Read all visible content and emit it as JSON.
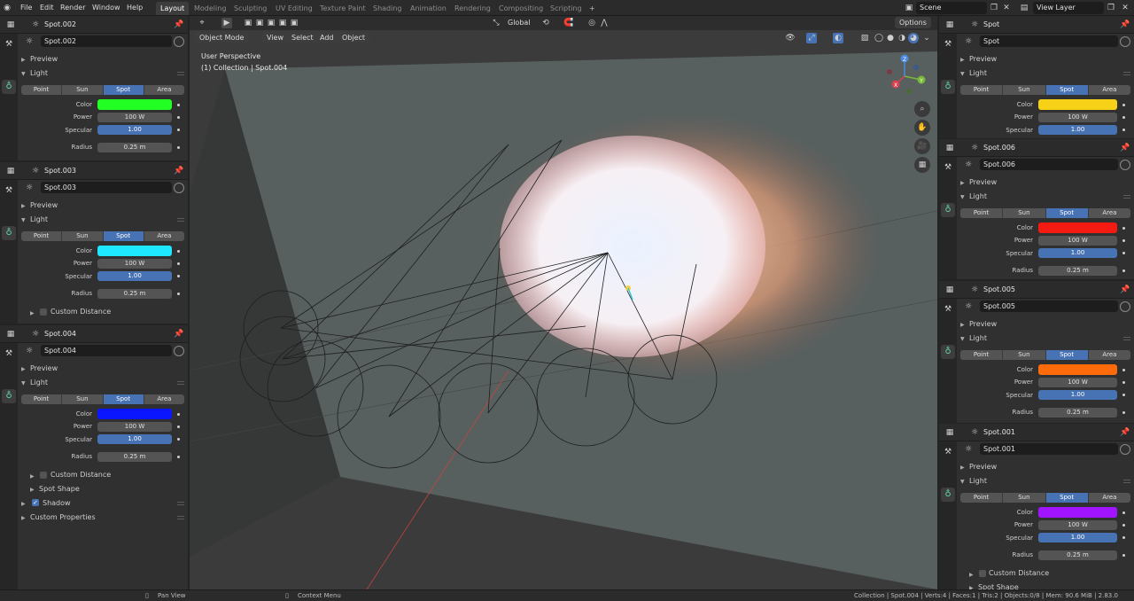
{
  "menu": [
    "File",
    "Edit",
    "Render",
    "Window",
    "Help"
  ],
  "workspaces": [
    "Layout",
    "Modeling",
    "Sculpting",
    "UV Editing",
    "Texture Paint",
    "Shading",
    "Animation",
    "Rendering",
    "Compositing",
    "Scripting"
  ],
  "active_workspace": "Layout",
  "add_workspace": "+",
  "scene": "Scene",
  "view_layer": "View Layer",
  "viewport": {
    "mode": "Object Mode",
    "menus": [
      "View",
      "Select",
      "Add",
      "Object"
    ],
    "orientation": "Global",
    "options": "Options",
    "perspective": "User Perspective",
    "collection": "(1) Collection | Spot.004",
    "gizmo_axes": [
      "X",
      "Y",
      "Z"
    ]
  },
  "light_types": [
    "Point",
    "Sun",
    "Spot",
    "Area"
  ],
  "labels": {
    "preview": "Preview",
    "light": "Light",
    "color": "Color",
    "power": "Power",
    "specular": "Specular",
    "radius": "Radius",
    "custom_distance": "Custom Distance",
    "spot_shape": "Spot Shape",
    "shadow": "Shadow",
    "custom_properties": "Custom Properties"
  },
  "left_panels": [
    {
      "name": "Spot.002",
      "type": "Spot",
      "color": "#22ff22",
      "power": "100 W",
      "specular": "1.00",
      "radius": "0.25 m"
    },
    {
      "name": "Spot.003",
      "type": "Spot",
      "color": "#1ee8ff",
      "power": "100 W",
      "specular": "1.00",
      "radius": "0.25 m"
    },
    {
      "name": "Spot.004",
      "type": "Spot",
      "color": "#0a16ff",
      "power": "100 W",
      "specular": "1.00",
      "radius": "0.25 m"
    }
  ],
  "right_panels": [
    {
      "name": "Spot",
      "type": "Spot",
      "color": "#f7d117",
      "power": "100 W",
      "specular": "1.00"
    },
    {
      "name": "Spot.006",
      "type": "Spot",
      "color": "#f51a12",
      "power": "100 W",
      "specular": "1.00",
      "radius": "0.25 m"
    },
    {
      "name": "Spot.005",
      "type": "Spot",
      "color": "#ff6a0a",
      "power": "100 W",
      "specular": "1.00",
      "radius": "0.25 m"
    },
    {
      "name": "Spot.001",
      "type": "Spot",
      "color": "#a014ff",
      "power": "100 W",
      "specular": "1.00",
      "radius": "0.25 m"
    }
  ],
  "status": {
    "pan": "Pan View",
    "context": "Context Menu",
    "info": "Collection | Spot.004 | Verts:4 | Faces:1 | Tris:2 | Objects:0/8 | Mem: 90.6 MiB | 2.83.0"
  }
}
